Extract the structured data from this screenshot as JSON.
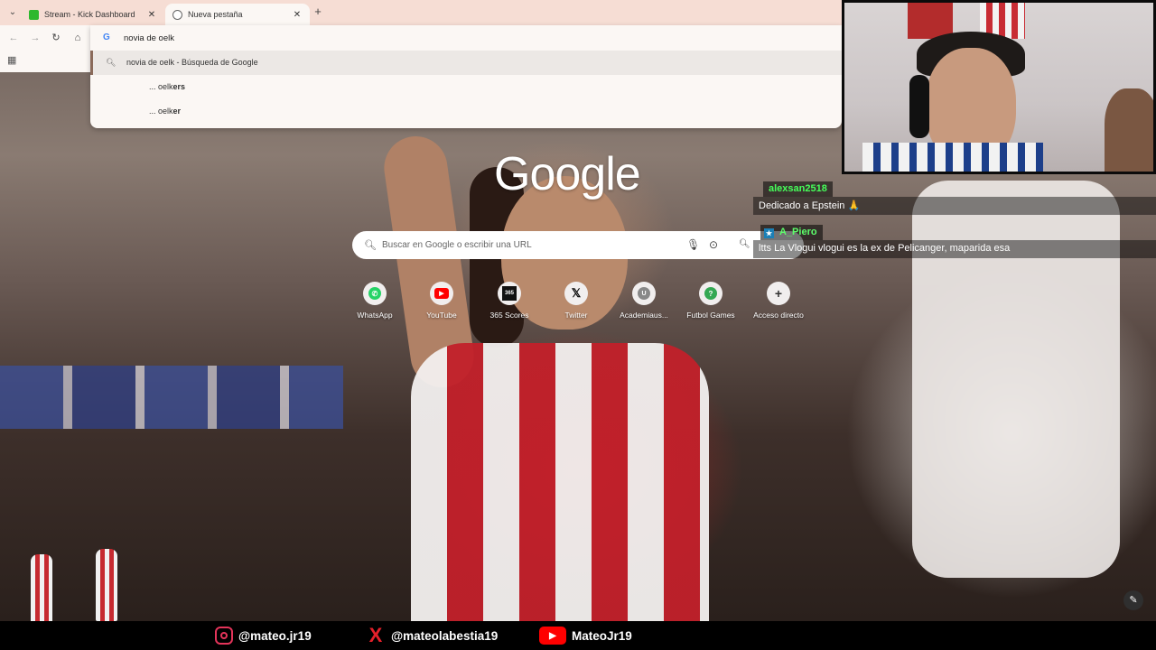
{
  "browser": {
    "tabs": [
      {
        "title": "Stream - Kick Dashboard",
        "active": false
      },
      {
        "title": "Nueva pestaña",
        "active": true
      }
    ],
    "omnibox": {
      "value": "novia de oelk",
      "suggestions": [
        {
          "text": "novia de oelk - Búsqueda de Google",
          "prefix": "",
          "bold": "",
          "selected": true
        },
        {
          "text": "",
          "prefix": "... oelk",
          "bold": "ers",
          "selected": false
        },
        {
          "text": "",
          "prefix": "... oelk",
          "bold": "er",
          "selected": false
        }
      ]
    }
  },
  "newtab": {
    "logo": "Google",
    "search_placeholder": "Buscar en Google o escribir una URL",
    "shortcuts": [
      {
        "label": "WhatsApp",
        "icon": "whatsapp-icon"
      },
      {
        "label": "YouTube",
        "icon": "youtube-icon"
      },
      {
        "label": "365 Scores",
        "icon": "365-scores-icon"
      },
      {
        "label": "Twitter",
        "icon": "x-twitter-icon"
      },
      {
        "label": "Academiaus...",
        "icon": "u-letter-icon"
      },
      {
        "label": "Futbol Games",
        "icon": "question-icon"
      },
      {
        "label": "Acceso directo",
        "icon": "plus-icon"
      }
    ]
  },
  "chat": [
    {
      "user": "alexsan2518",
      "message": "Dedicado a Epstein 🙏"
    },
    {
      "user": "A_Piero",
      "message": "ltts La Vlogui vlogui es la ex de Pelicanger, maparida esa"
    }
  ],
  "socials": [
    {
      "handle": "@mateo.jr19",
      "icon": "instagram-icon"
    },
    {
      "handle": "@mateolabestia19",
      "icon": "x-logo-icon"
    },
    {
      "handle": "MateoJr19",
      "icon": "youtube-icon"
    }
  ],
  "colors": {
    "tabbar": "#f6ddd4",
    "chat_username": "#46ff5a",
    "instagram": "#e4345a",
    "x_red": "#e4202a",
    "youtube": "#ff0000"
  }
}
